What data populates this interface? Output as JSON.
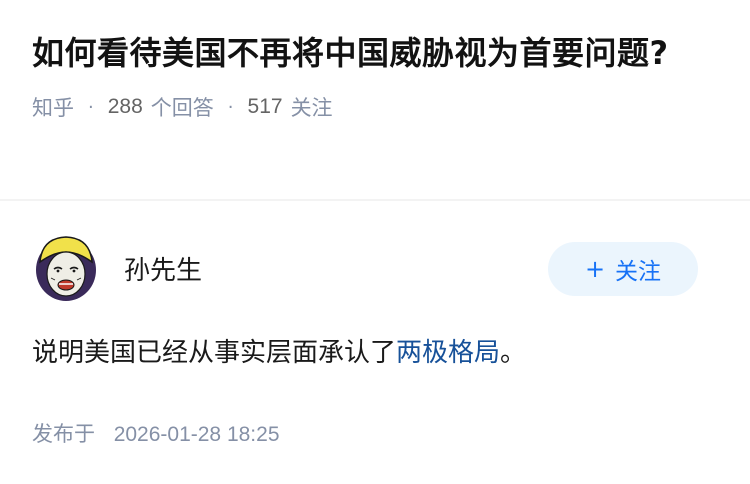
{
  "question": {
    "title": "如何看待美国不再将中国威胁视为首要问题?",
    "source": "知乎",
    "answer_count": "288",
    "answer_label": "个回答",
    "follower_count": "517",
    "follower_label": "关注",
    "separator": "·"
  },
  "author": {
    "name": "孙先生",
    "avatar_icon": "cartoon-face-avatar",
    "follow_plus": "+",
    "follow_label": "关注"
  },
  "answer": {
    "text_before": "说明美国已经从事实层面承认了",
    "link_text": "两极格局",
    "text_after": "。"
  },
  "published": {
    "label": "发布于",
    "datetime": "2026-01-28 18:25"
  },
  "colors": {
    "meta_gray": "#8590a6",
    "link_blue": "#175199",
    "follow_blue": "#1772f6",
    "follow_bg": "#ebf5fd"
  }
}
